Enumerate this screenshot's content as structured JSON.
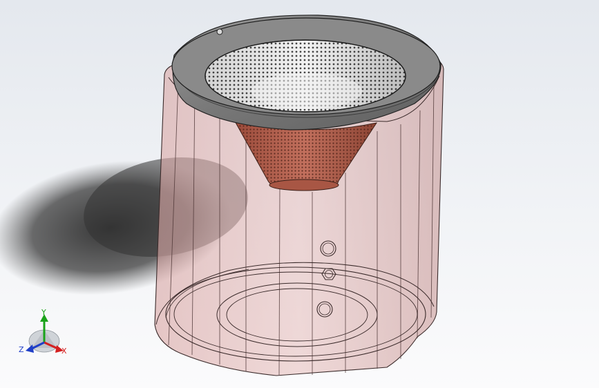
{
  "viewport": {
    "background_top": "#e4e8ee",
    "background_bottom": "#fbfbfc"
  },
  "model": {
    "housing_color": "#c98f8c",
    "cone_color": "#b5604d",
    "flange_color": "#6e6e6e",
    "mesh_hole_color": "#2b2b2b",
    "edge_color": "#3a2a2a"
  },
  "triad": {
    "y_label": "Y",
    "z_label": "Z",
    "x_label": "X",
    "y_color": "#1aa31a",
    "x_color": "#d42020",
    "z_color": "#1f3fc7"
  }
}
